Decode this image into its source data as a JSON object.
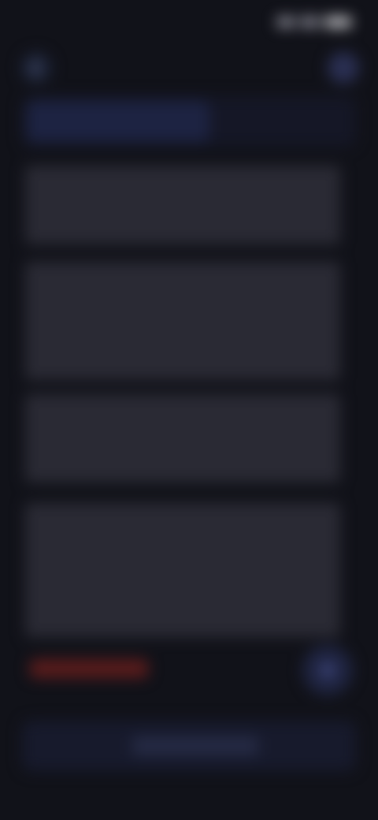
{
  "status_bar": {
    "time": "",
    "signal_icon": "signal-icon",
    "wifi_icon": "wifi-icon",
    "battery_icon": "battery-icon"
  },
  "header": {
    "back_icon": "chevron-left-icon",
    "title": "",
    "menu_icon": "menu-icon"
  },
  "tabs": [
    {
      "label": ""
    },
    {
      "label": ""
    }
  ],
  "content": {
    "paragraphs": [
      "",
      "",
      "",
      ""
    ]
  },
  "footer": {
    "link_text": "",
    "fab_icon": "circle-icon",
    "primary_button_label": ""
  },
  "colors": {
    "background": "#111219",
    "accent": "#1d2342",
    "link": "#c2352b"
  }
}
